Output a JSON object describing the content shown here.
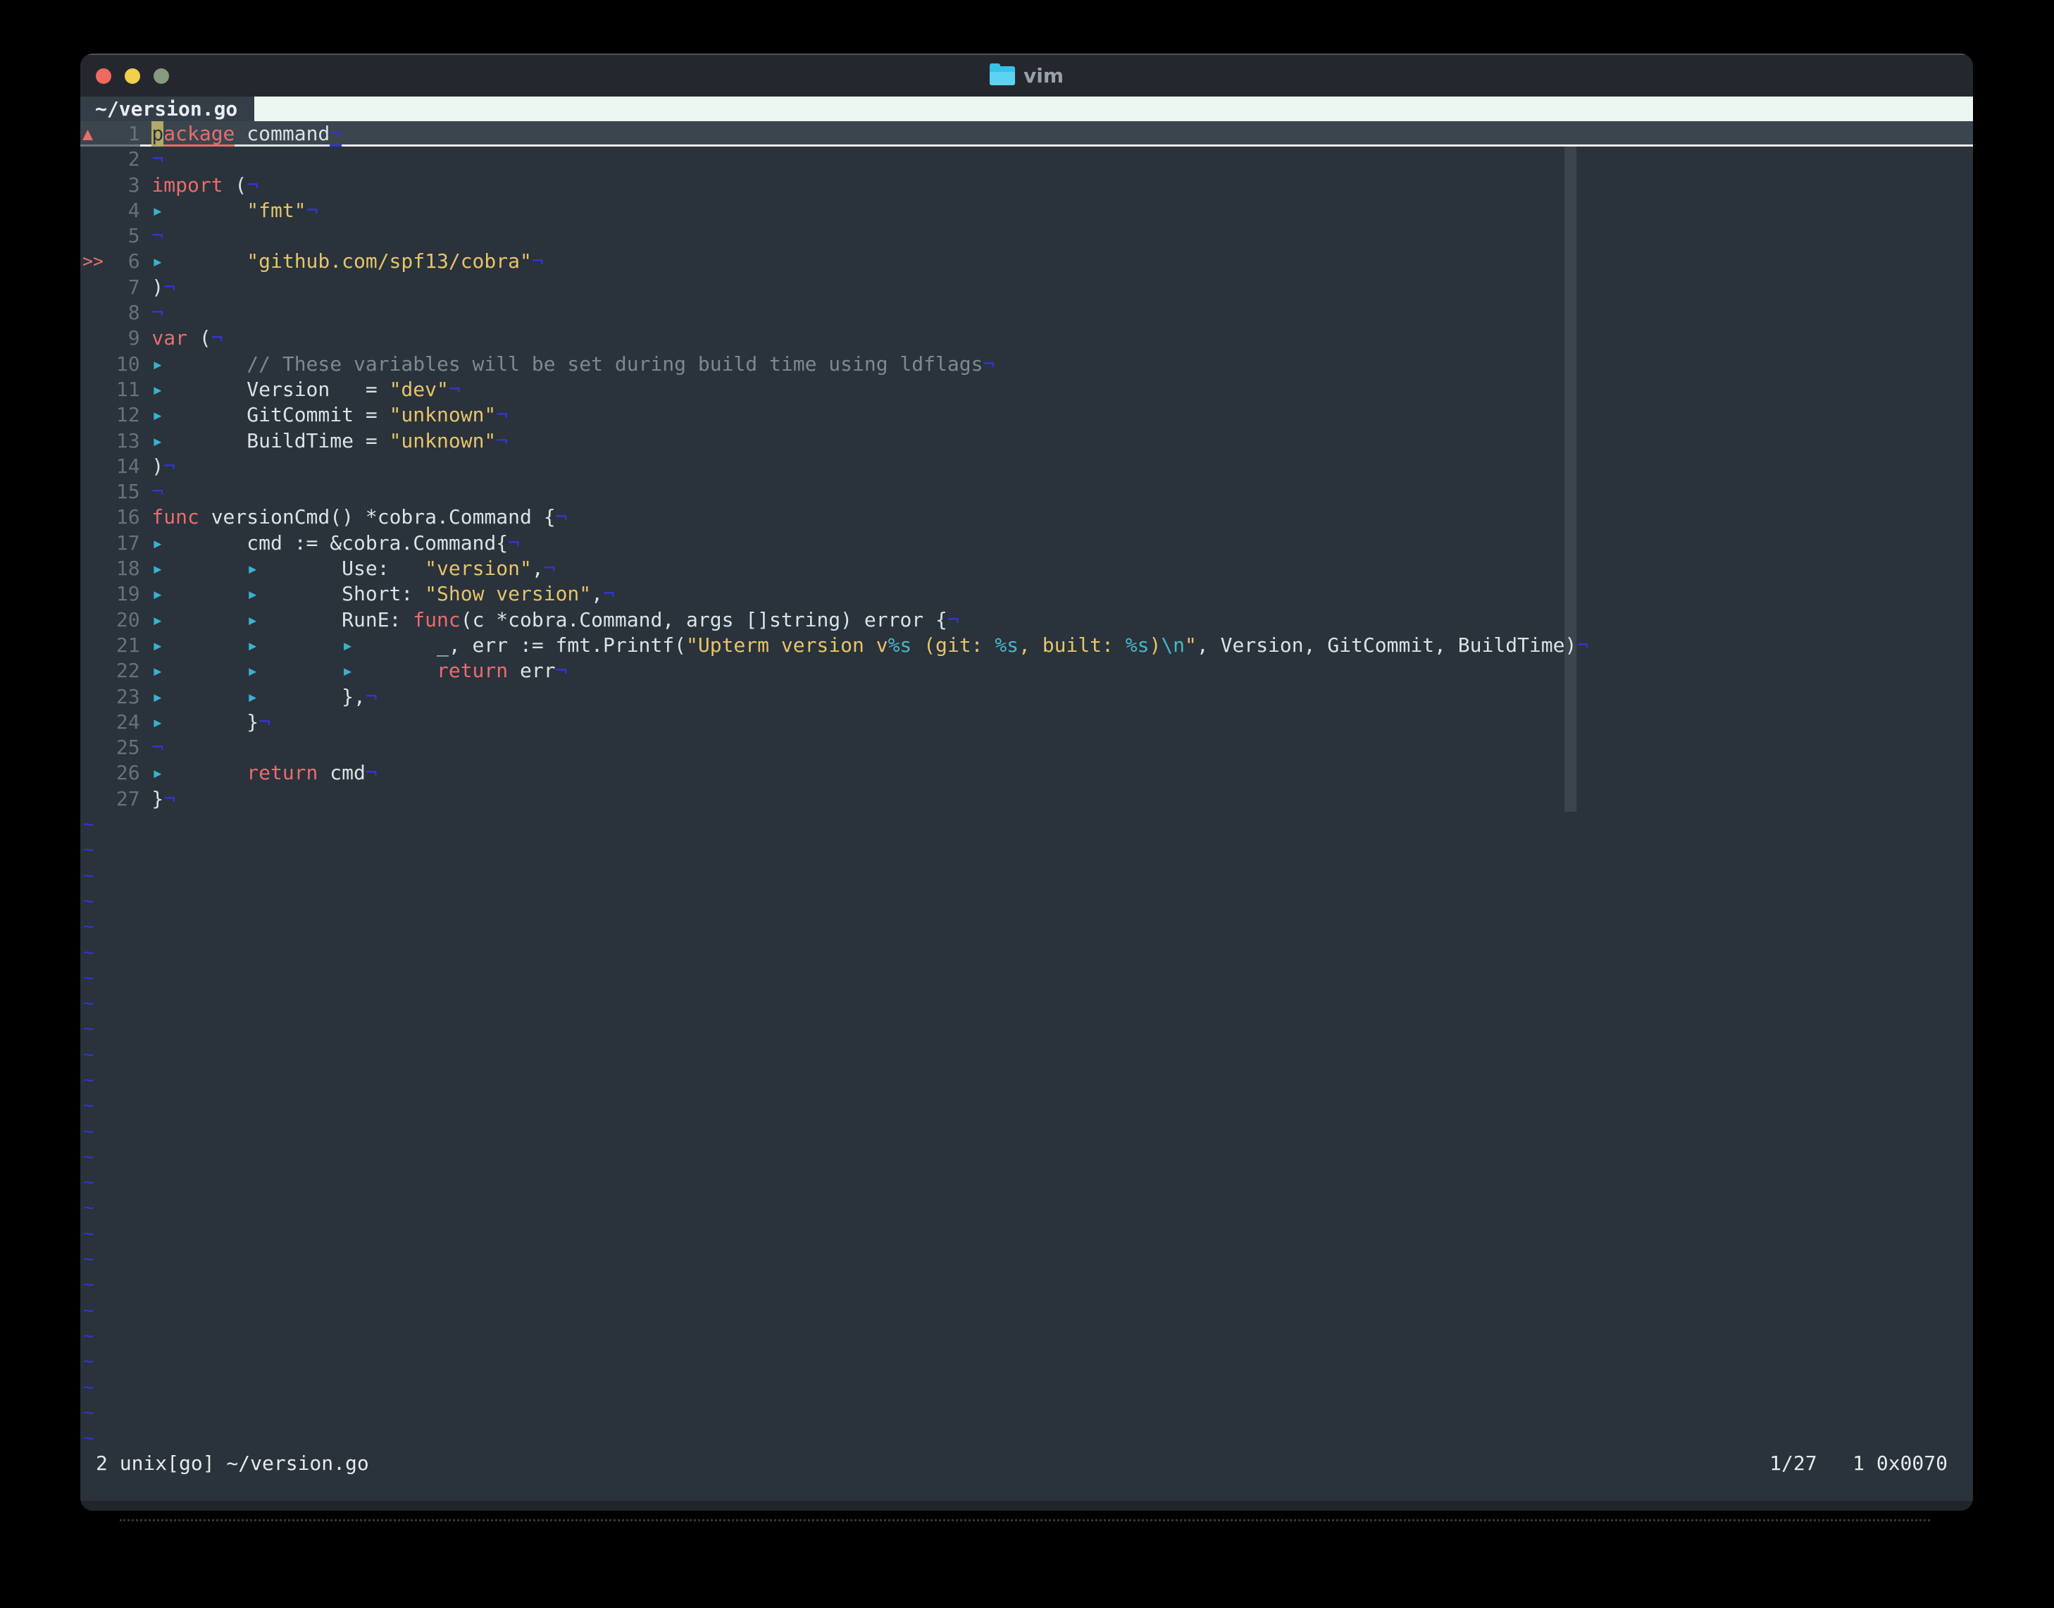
{
  "window": {
    "title": "vim",
    "traffic_lights": [
      "close",
      "minimize",
      "zoom"
    ]
  },
  "tabline": {
    "active_tab": "~/version.go"
  },
  "editor": {
    "eol_marker": "¬",
    "tab_marker": "▸",
    "tilde_marker": "~",
    "tilde_count": 25,
    "cursor": {
      "line": 1,
      "col": 1,
      "char": "p"
    },
    "lines": [
      {
        "n": 1,
        "sign": "▲",
        "cursorline": true,
        "segs": [
          [
            "cursor",
            "p"
          ],
          [
            "kw",
            "ackage"
          ],
          [
            "def",
            " command"
          ]
        ]
      },
      {
        "n": 2,
        "segs": []
      },
      {
        "n": 3,
        "segs": [
          [
            "kw",
            "import"
          ],
          [
            "def",
            " ("
          ]
        ]
      },
      {
        "n": 4,
        "segs": [
          [
            "tab",
            "▸"
          ],
          [
            "str",
            "\"fmt\""
          ]
        ]
      },
      {
        "n": 5,
        "segs": []
      },
      {
        "n": 6,
        "sign": ">>",
        "segs": [
          [
            "tab",
            "▸"
          ],
          [
            "str",
            "\"github.com/spf13/cobra\""
          ]
        ]
      },
      {
        "n": 7,
        "segs": [
          [
            "def",
            ")"
          ]
        ]
      },
      {
        "n": 8,
        "segs": []
      },
      {
        "n": 9,
        "segs": [
          [
            "kw",
            "var"
          ],
          [
            "def",
            " ("
          ]
        ]
      },
      {
        "n": 10,
        "segs": [
          [
            "tab",
            "▸"
          ],
          [
            "com",
            "// These variables will be set during build time using ldflags"
          ]
        ]
      },
      {
        "n": 11,
        "segs": [
          [
            "tab",
            "▸"
          ],
          [
            "def",
            "Version   = "
          ],
          [
            "str",
            "\"dev\""
          ]
        ]
      },
      {
        "n": 12,
        "segs": [
          [
            "tab",
            "▸"
          ],
          [
            "def",
            "GitCommit = "
          ],
          [
            "str",
            "\"unknown\""
          ]
        ]
      },
      {
        "n": 13,
        "segs": [
          [
            "tab",
            "▸"
          ],
          [
            "def",
            "BuildTime = "
          ],
          [
            "str",
            "\"unknown\""
          ]
        ]
      },
      {
        "n": 14,
        "segs": [
          [
            "def",
            ")"
          ]
        ]
      },
      {
        "n": 15,
        "segs": []
      },
      {
        "n": 16,
        "segs": [
          [
            "kw",
            "func"
          ],
          [
            "def",
            " versionCmd() *cobra.Command {"
          ]
        ]
      },
      {
        "n": 17,
        "segs": [
          [
            "tab",
            "▸"
          ],
          [
            "def",
            "cmd := &cobra.Command{"
          ]
        ]
      },
      {
        "n": 18,
        "segs": [
          [
            "tab",
            "▸"
          ],
          [
            "tab",
            "▸"
          ],
          [
            "def",
            "Use:   "
          ],
          [
            "str",
            "\"version\""
          ],
          [
            "def",
            ","
          ]
        ]
      },
      {
        "n": 19,
        "segs": [
          [
            "tab",
            "▸"
          ],
          [
            "tab",
            "▸"
          ],
          [
            "def",
            "Short: "
          ],
          [
            "str",
            "\"Show version\""
          ],
          [
            "def",
            ","
          ]
        ]
      },
      {
        "n": 20,
        "segs": [
          [
            "tab",
            "▸"
          ],
          [
            "tab",
            "▸"
          ],
          [
            "def",
            "RunE: "
          ],
          [
            "kw",
            "func"
          ],
          [
            "def",
            "(c *cobra.Command, args []string) error {"
          ]
        ]
      },
      {
        "n": 21,
        "segs": [
          [
            "tab",
            "▸"
          ],
          [
            "tab",
            "▸"
          ],
          [
            "tab",
            "▸"
          ],
          [
            "def",
            "_, err := fmt.Printf("
          ],
          [
            "str",
            "\"Upterm version v"
          ],
          [
            "fmt",
            "%s"
          ],
          [
            "str",
            " (git: "
          ],
          [
            "fmt",
            "%s"
          ],
          [
            "str",
            ", built: "
          ],
          [
            "fmt",
            "%s"
          ],
          [
            "str",
            ")"
          ],
          [
            "fmt",
            "\\n"
          ],
          [
            "str",
            "\""
          ],
          [
            "def",
            ", Version, GitCommit, BuildTime)"
          ]
        ]
      },
      {
        "n": 22,
        "segs": [
          [
            "tab",
            "▸"
          ],
          [
            "tab",
            "▸"
          ],
          [
            "tab",
            "▸"
          ],
          [
            "kw",
            "return"
          ],
          [
            "def",
            " err"
          ]
        ]
      },
      {
        "n": 23,
        "segs": [
          [
            "tab",
            "▸"
          ],
          [
            "tab",
            "▸"
          ],
          [
            "def",
            "},"
          ]
        ]
      },
      {
        "n": 24,
        "segs": [
          [
            "tab",
            "▸"
          ],
          [
            "def",
            "}"
          ]
        ]
      },
      {
        "n": 25,
        "segs": []
      },
      {
        "n": 26,
        "segs": [
          [
            "tab",
            "▸"
          ],
          [
            "kw",
            "return"
          ],
          [
            "def",
            " cmd"
          ]
        ]
      },
      {
        "n": 27,
        "segs": [
          [
            "def",
            "}"
          ]
        ]
      }
    ]
  },
  "statusline": {
    "left": "2 unix[go] ~/version.go",
    "right": "1/27   1 0x0070",
    "ruler": "1/27",
    "column": "1",
    "char_value": "0x0070"
  },
  "colors": {
    "background": "#2a323b",
    "titlebar": "#24282e",
    "tab_active_bg": "#343e48",
    "tab_fill": "#ecf7f1",
    "cursorline_bg": "#3b454e",
    "keyword": "#e96d6d",
    "string": "#e7c469",
    "format_spec": "#46b7c8",
    "comment": "#7f8890",
    "line_number": "#68717b",
    "eol_blue": "#3434d6",
    "tab_marker_teal": "#38b2d2",
    "sign_red": "#ec6e67",
    "cursor_block": "#b3a968",
    "colorcolumn": "#3c454e",
    "traffic_close": "#ef6a5e",
    "traffic_minimize": "#f2cf4d",
    "traffic_zoom": "#87997e"
  }
}
